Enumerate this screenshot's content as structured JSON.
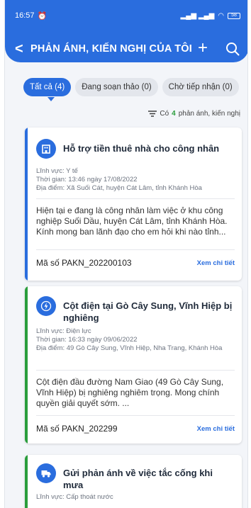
{
  "status_bar": {
    "time": "16:57",
    "battery": "58"
  },
  "header": {
    "title": "PHẢN ÁNH, KIẾN NGHỊ CỦA TÔI"
  },
  "tabs": [
    {
      "label": "Tất cả (4)",
      "active": true
    },
    {
      "label": "Đang soạn thảo (0)",
      "active": false
    },
    {
      "label": "Chờ tiếp nhận (0)",
      "active": false
    }
  ],
  "count": {
    "prefix": "Có",
    "number": "4",
    "suffix": "phản ánh, kiến nghị"
  },
  "items": [
    {
      "title": "Hỗ trợ tiền thuê  nhà cho công nhân",
      "field": "Lĩnh vực: Y tế",
      "time": "Thời gian: 13:46 ngày 17/08/2022",
      "place": "Địa điểm: Xã Suối Cát, huyện Cát Lâm, tỉnh Khánh Hòa",
      "description": "Hiện tại e đang là công nhân làm việc ở khu công nghiệp Suối Dầu, huyện Cát Lâm, tỉnh Khánh Hòa. Kính mong ban lãnh đạo cho em hỏi khi nào tỉnh...",
      "code": "Mã số PAKN_202200103",
      "detail_label": "Xem chi tiết",
      "bar_color": "#2a6dde",
      "icon": "building-icon"
    },
    {
      "title": "Cột điện tại Gò Cây Sung, Vĩnh Hiệp bị nghiêng",
      "field": "Lĩnh vực: Điện lực",
      "time": "Thời gian: 16:33 ngày 09/06/2022",
      "place": "Địa điểm: 49 Gò Cây Sung, Vĩnh Hiệp, Nha Trang, Khánh Hòa",
      "description": "Cột điện đầu đường Nam Giao (49 Gò Cây Sung, Vĩnh Hiệp) bị nghiêng nghiêm trọng. Mong chính quyền giải quyết sớm. ...",
      "code": "Mã số PAKN_202299",
      "detail_label": "Xem chi tiết",
      "bar_color": "#2a9d3c",
      "icon": "lightning-icon"
    },
    {
      "title": "Gửi phản ánh về việc tắc cống khi mưa",
      "field": "Lĩnh vực: Cấp thoát nước",
      "bar_color": "#2a9d3c",
      "icon": "truck-icon"
    }
  ]
}
